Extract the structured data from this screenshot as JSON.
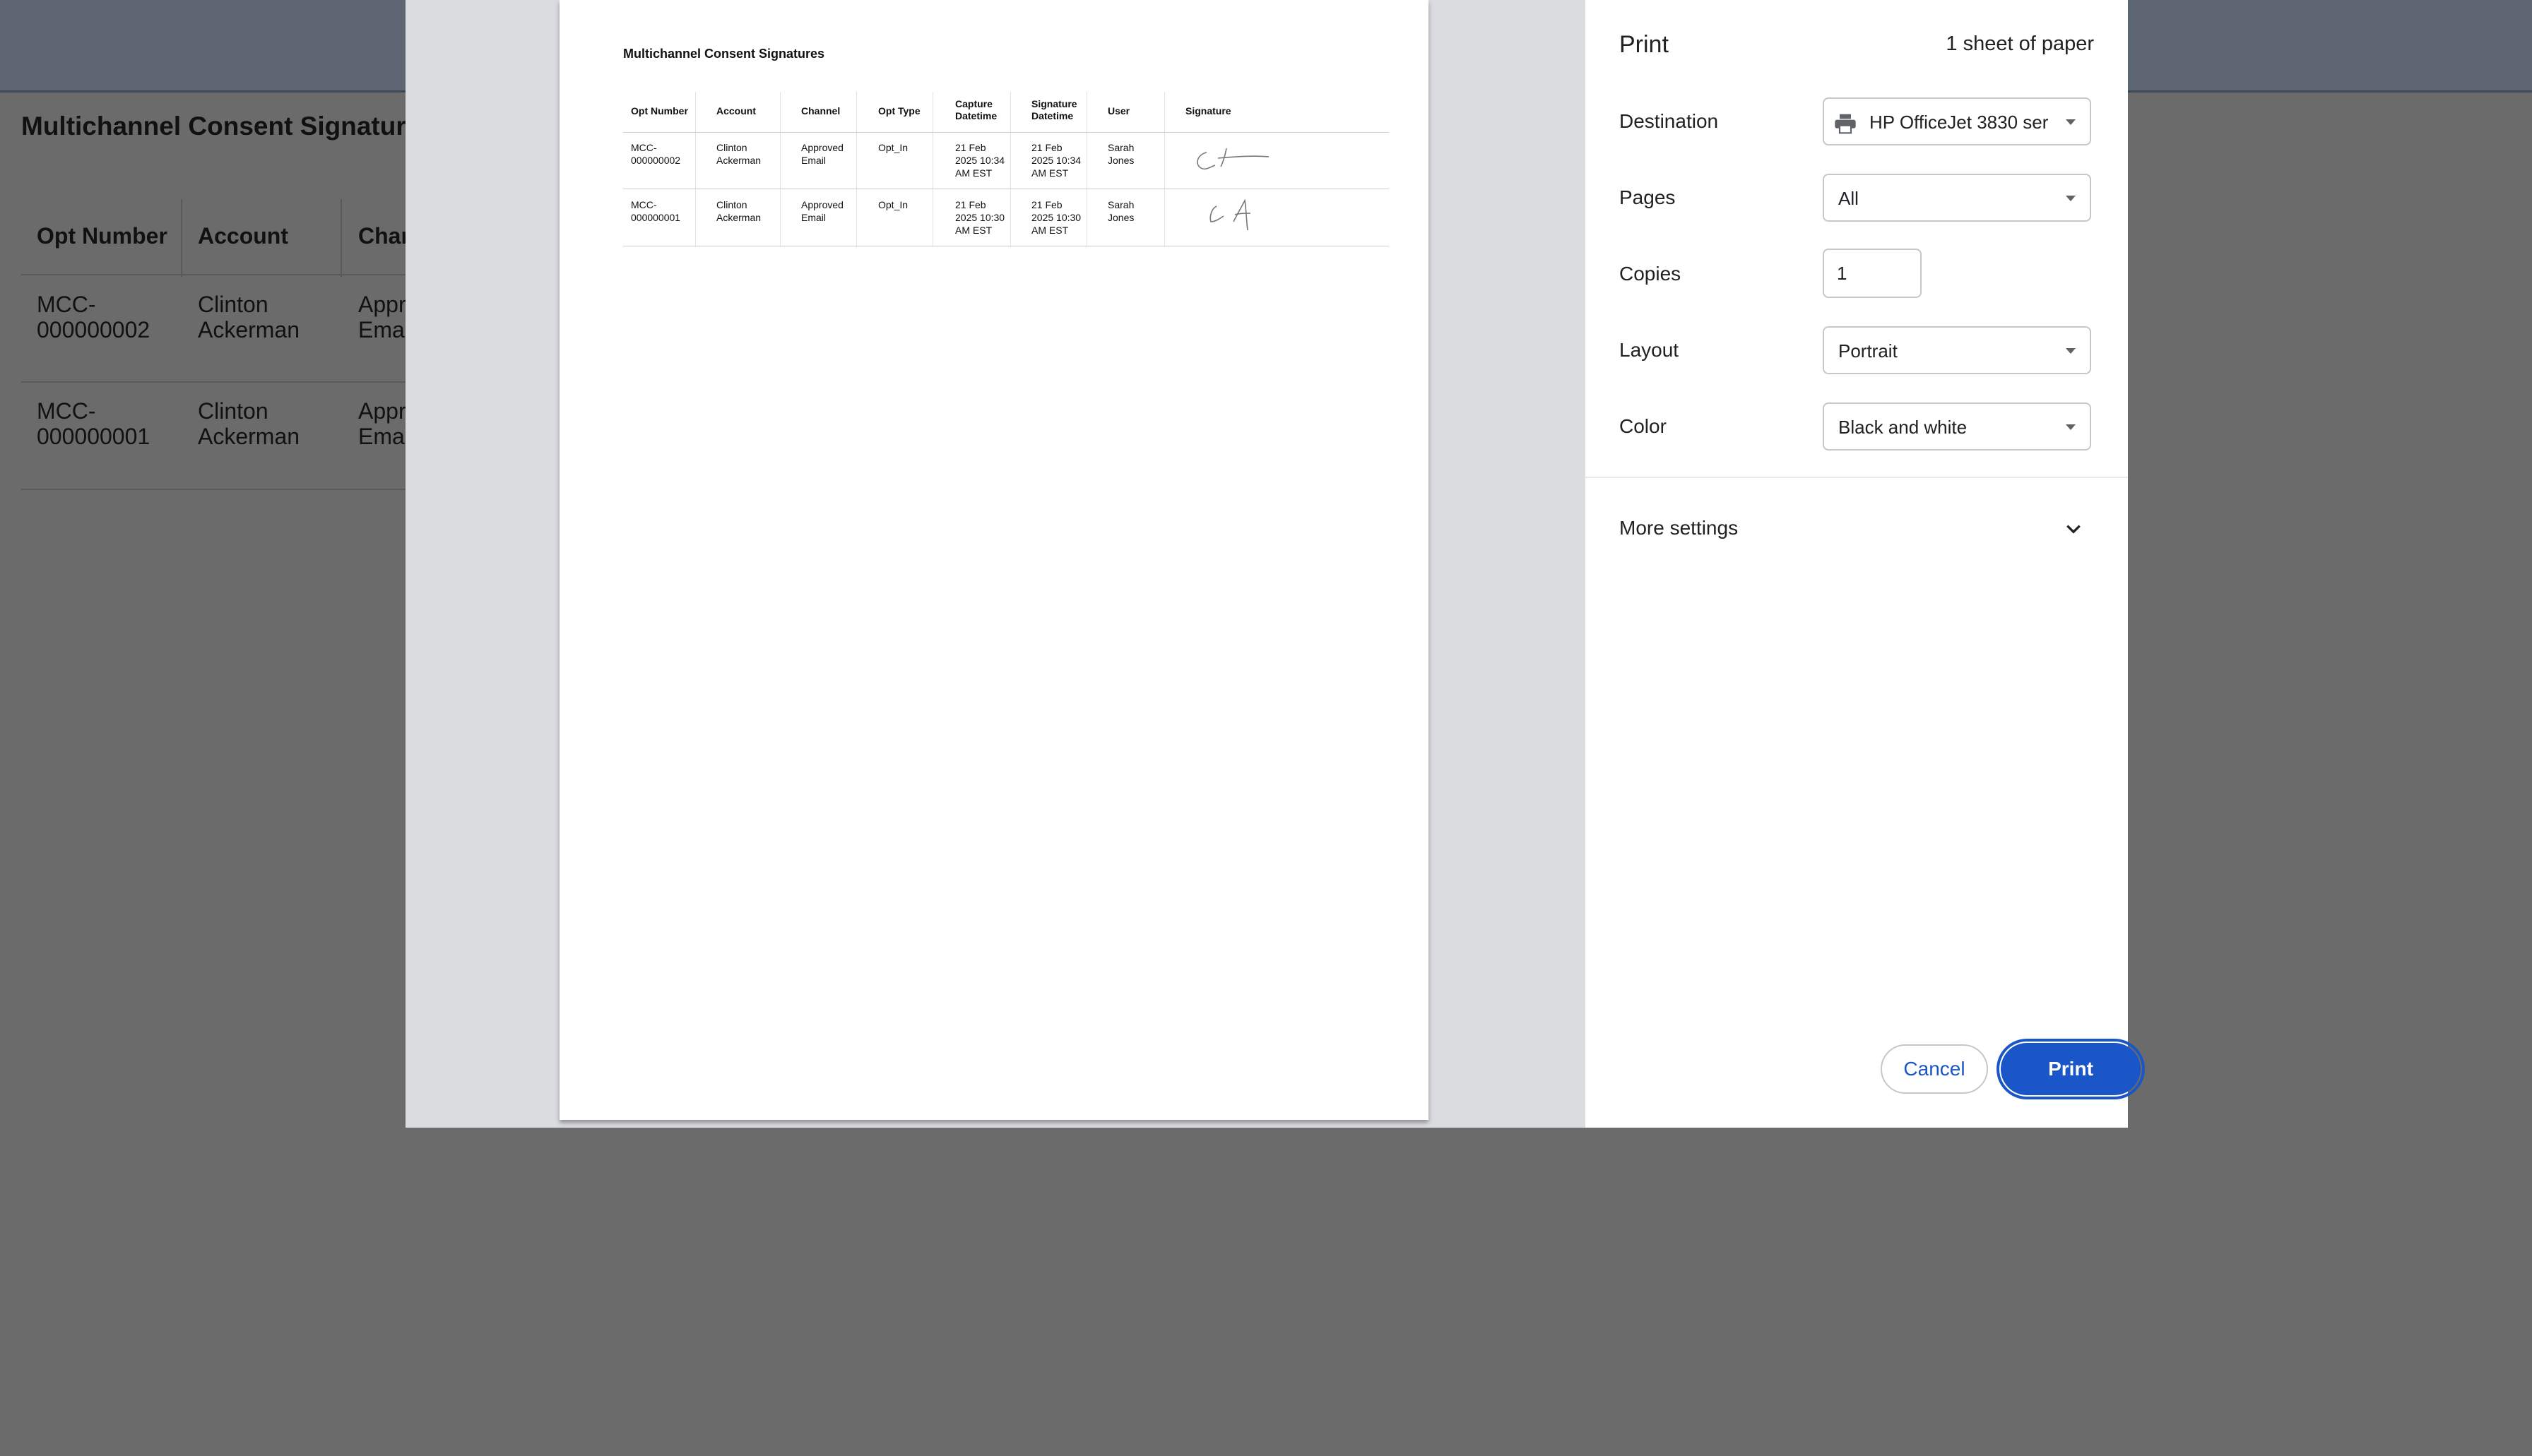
{
  "background": {
    "title": "Multichannel Consent Signatures",
    "columns": [
      "Opt Number",
      "Account",
      "Char"
    ],
    "rows": [
      {
        "opt_number_1": "MCC-",
        "opt_number_2": "000000002",
        "account_1": "Clinton",
        "account_2": "Ackerman",
        "channel_1": "Appro",
        "channel_2": "Emai"
      },
      {
        "opt_number_1": "MCC-",
        "opt_number_2": "000000001",
        "account_1": "Clinton",
        "account_2": "Ackerman",
        "channel_1": "Appro",
        "channel_2": "Emai"
      }
    ]
  },
  "preview": {
    "title": "Multichannel Consent Signatures",
    "headers": {
      "opt_number": "Opt Number",
      "account": "Account",
      "channel": "Channel",
      "opt_type": "Opt Type",
      "capture_1": "Capture",
      "capture_2": "Datetime",
      "signature_dt_1": "Signature",
      "signature_dt_2": "Datetime",
      "user": "User",
      "signature": "Signature"
    },
    "rows": [
      {
        "opt_1": "MCC-",
        "opt_2": "000000002",
        "acc_1": "Clinton",
        "acc_2": "Ackerman",
        "ch_1": "Approved",
        "ch_2": "Email",
        "opt_type": "Opt_In",
        "cap_1": "21 Feb",
        "cap_2": "2025 10:34",
        "cap_3": "AM EST",
        "sig_1": "21 Feb",
        "sig_2": "2025 10:34",
        "sig_3": "AM EST",
        "user_1": "Sarah",
        "user_2": "Jones"
      },
      {
        "opt_1": "MCC-",
        "opt_2": "000000001",
        "acc_1": "Clinton",
        "acc_2": "Ackerman",
        "ch_1": "Approved",
        "ch_2": "Email",
        "opt_type": "Opt_In",
        "cap_1": "21 Feb",
        "cap_2": "2025 10:30",
        "cap_3": "AM EST",
        "sig_1": "21 Feb",
        "sig_2": "2025 10:30",
        "sig_3": "AM EST",
        "user_1": "Sarah",
        "user_2": "Jones"
      }
    ]
  },
  "print_panel": {
    "title": "Print",
    "sheet_count": "1 sheet of paper",
    "destination_label": "Destination",
    "destination_value": "HP OfficeJet 3830 ser",
    "destination_icon": "printer-icon",
    "pages_label": "Pages",
    "pages_value": "All",
    "copies_label": "Copies",
    "copies_value": "1",
    "layout_label": "Layout",
    "layout_value": "Portrait",
    "color_label": "Color",
    "color_value": "Black and white",
    "more_settings_label": "More settings",
    "more_settings_icon": "chevron-down-icon",
    "cancel_label": "Cancel",
    "print_label": "Print"
  },
  "colors": {
    "primary_blue": "#1a56c7",
    "overlay_gray": "#6b6b6b",
    "preview_background": "#dadce0"
  }
}
